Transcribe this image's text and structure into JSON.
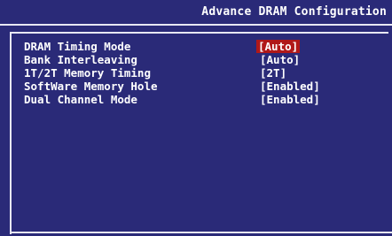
{
  "header": {
    "title": "Advance DRAM Configuration"
  },
  "settings": [
    {
      "label": "DRAM Timing Mode",
      "value": "[Auto]",
      "selected": true
    },
    {
      "label": "Bank Interleaving",
      "value": "[Auto]",
      "selected": false
    },
    {
      "label": "1T/2T Memory Timing",
      "value": "[2T]",
      "selected": false
    },
    {
      "label": "SoftWare Memory Hole",
      "value": "[Enabled]",
      "selected": false
    },
    {
      "label": "Dual Channel Mode",
      "value": "[Enabled]",
      "selected": false
    }
  ],
  "colors": {
    "background": "#2a2a78",
    "text": "#ffffff",
    "highlight": "#b01818",
    "border": "#e8e8f4"
  }
}
